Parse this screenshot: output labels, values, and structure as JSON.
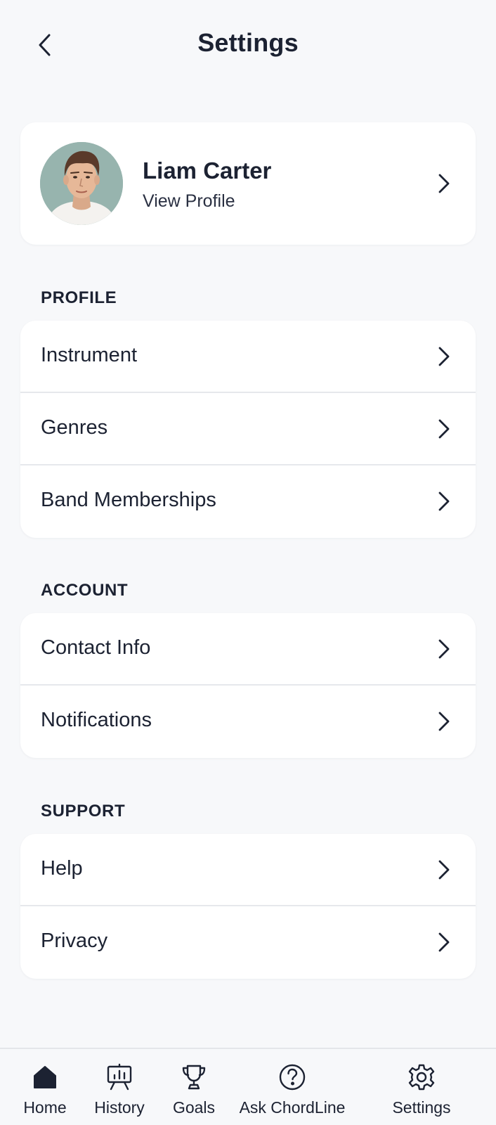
{
  "header": {
    "title": "Settings",
    "back_icon": "chevron-left-icon"
  },
  "profile": {
    "name": "Liam Carter",
    "subtitle": "View Profile"
  },
  "sections": [
    {
      "label": "PROFILE",
      "items": [
        {
          "label": "Instrument"
        },
        {
          "label": "Genres"
        },
        {
          "label": "Band Memberships"
        }
      ]
    },
    {
      "label": "ACCOUNT",
      "items": [
        {
          "label": "Contact Info"
        },
        {
          "label": "Notifications"
        }
      ]
    },
    {
      "label": "SUPPORT",
      "items": [
        {
          "label": "Help"
        },
        {
          "label": "Privacy"
        }
      ]
    }
  ],
  "nav": [
    {
      "label": "Home",
      "icon": "home-icon",
      "active": true
    },
    {
      "label": "History",
      "icon": "chart-board-icon"
    },
    {
      "label": "Goals",
      "icon": "trophy-icon"
    },
    {
      "label": "Ask ChordLine",
      "icon": "help-circle-icon"
    },
    {
      "label": "Settings",
      "icon": "gear-icon"
    }
  ],
  "colors": {
    "background": "#f7f8fa",
    "card": "#ffffff",
    "text": "#1c2232",
    "divider": "#e6e8ec",
    "avatar_bg": "#97b4ae"
  }
}
